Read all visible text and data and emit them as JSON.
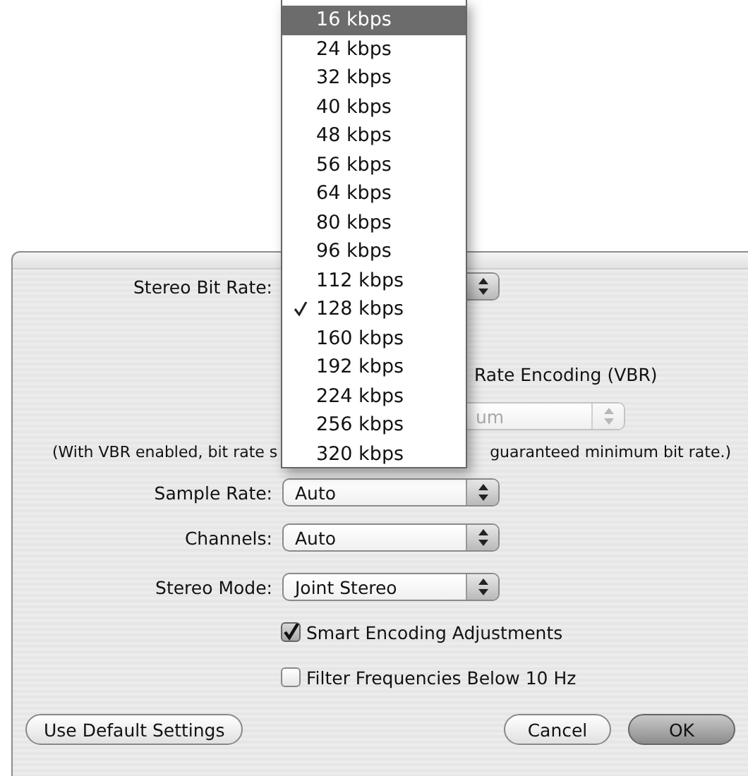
{
  "dialog": {
    "stereo_bit_rate": {
      "label": "Stereo Bit Rate:"
    },
    "vbr": {
      "label": "Rate Encoding (VBR)"
    },
    "quality": {
      "value": "um",
      "disabled": true
    },
    "note": [
      "(With VBR enabled, bit rate s",
      "guaranteed minimum bit rate.)"
    ],
    "fields": [
      {
        "label": "Sample Rate:",
        "value": "Auto"
      },
      {
        "label": "Channels:",
        "value": "Auto"
      },
      {
        "label": "Stereo Mode:",
        "value": "Joint Stereo"
      }
    ],
    "checkboxes": [
      {
        "label": "Smart Encoding Adjustments",
        "checked": true
      },
      {
        "label": "Filter Frequencies Below 10 Hz",
        "checked": false
      }
    ],
    "buttons": [
      {
        "label": "Use Default Settings",
        "kind": "secondary"
      },
      {
        "label": "Cancel",
        "kind": "secondary"
      },
      {
        "label": "OK",
        "kind": "default"
      }
    ]
  },
  "menu": {
    "items": [
      {
        "label": "16 kbps",
        "selected": true,
        "checked": false
      },
      {
        "label": "24 kbps",
        "selected": false,
        "checked": false
      },
      {
        "label": "32 kbps",
        "selected": false,
        "checked": false
      },
      {
        "label": "40 kbps",
        "selected": false,
        "checked": false
      },
      {
        "label": "48 kbps",
        "selected": false,
        "checked": false
      },
      {
        "label": "56 kbps",
        "selected": false,
        "checked": false
      },
      {
        "label": "64 kbps",
        "selected": false,
        "checked": false
      },
      {
        "label": "80 kbps",
        "selected": false,
        "checked": false
      },
      {
        "label": "96 kbps",
        "selected": false,
        "checked": false
      },
      {
        "label": "112 kbps",
        "selected": false,
        "checked": false
      },
      {
        "label": "128 kbps",
        "selected": false,
        "checked": true
      },
      {
        "label": "160 kbps",
        "selected": false,
        "checked": false
      },
      {
        "label": "192 kbps",
        "selected": false,
        "checked": false
      },
      {
        "label": "224 kbps",
        "selected": false,
        "checked": false
      },
      {
        "label": "256 kbps",
        "selected": false,
        "checked": false
      },
      {
        "label": "320 kbps",
        "selected": false,
        "checked": false
      }
    ]
  }
}
